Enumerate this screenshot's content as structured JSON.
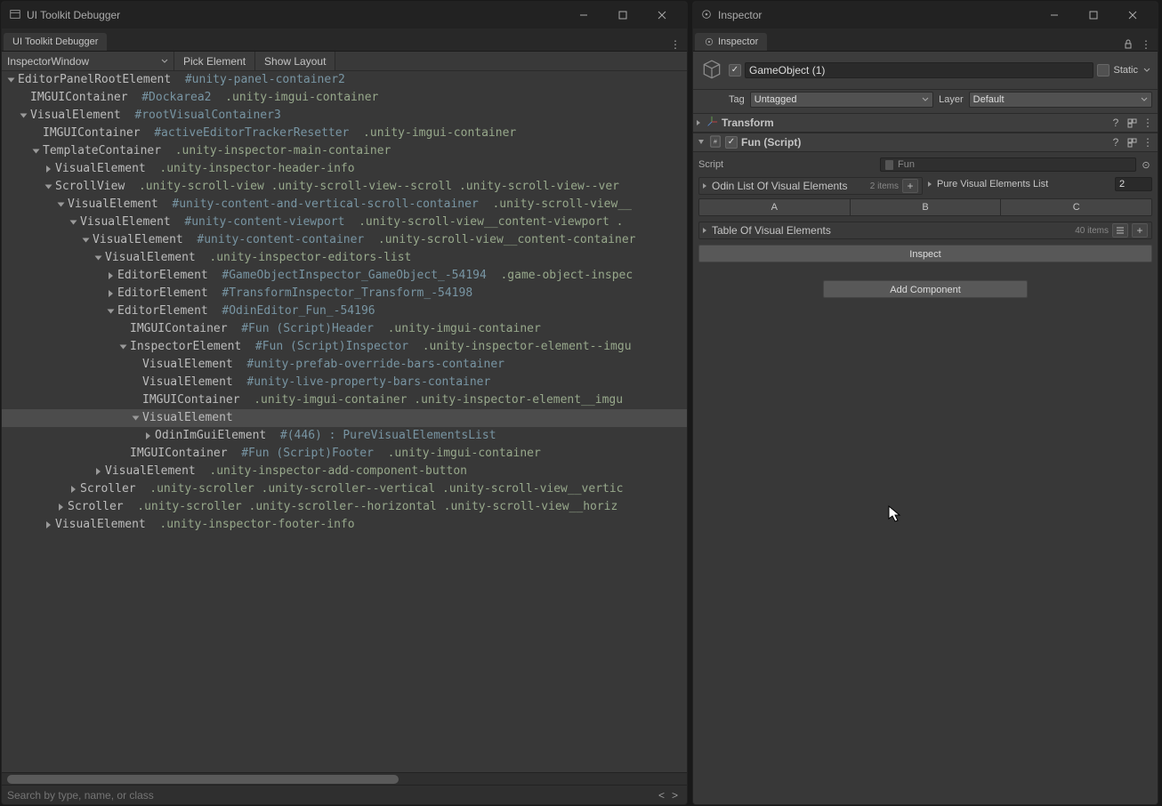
{
  "debugger": {
    "window_title": "UI Toolkit Debugger",
    "tab_label": "UI Toolkit Debugger",
    "target_dropdown": "InspectorWindow",
    "pick_element": "Pick Element",
    "show_layout": "Show Layout",
    "search_placeholder": "Search by type, name, or class",
    "nav_prev": "<",
    "nav_next": ">",
    "tree": [
      {
        "depth": 0,
        "fold": "open",
        "name": "EditorPanelRootElement",
        "id": "#unity-panel-container2",
        "cls": ""
      },
      {
        "depth": 1,
        "fold": "none",
        "name": "IMGUIContainer",
        "id": "#Dockarea2",
        "cls": ".unity-imgui-container"
      },
      {
        "depth": 1,
        "fold": "open",
        "name": "VisualElement",
        "id": "#rootVisualContainer3",
        "cls": ""
      },
      {
        "depth": 2,
        "fold": "none",
        "name": "IMGUIContainer",
        "id": "#activeEditorTrackerResetter",
        "cls": ".unity-imgui-container"
      },
      {
        "depth": 2,
        "fold": "open",
        "name": "TemplateContainer",
        "id": "",
        "cls": ".unity-inspector-main-container"
      },
      {
        "depth": 3,
        "fold": "closed",
        "name": "VisualElement",
        "id": "",
        "cls": ".unity-inspector-header-info"
      },
      {
        "depth": 3,
        "fold": "open",
        "name": "ScrollView",
        "id": "",
        "cls": ".unity-scroll-view  .unity-scroll-view--scroll  .unity-scroll-view--ver"
      },
      {
        "depth": 4,
        "fold": "open",
        "name": "VisualElement",
        "id": "#unity-content-and-vertical-scroll-container",
        "cls": ".unity-scroll-view__"
      },
      {
        "depth": 5,
        "fold": "open",
        "name": "VisualElement",
        "id": "#unity-content-viewport",
        "cls": ".unity-scroll-view__content-viewport  ."
      },
      {
        "depth": 6,
        "fold": "open",
        "name": "VisualElement",
        "id": "#unity-content-container",
        "cls": ".unity-scroll-view__content-container"
      },
      {
        "depth": 7,
        "fold": "open",
        "name": "VisualElement",
        "id": "",
        "cls": ".unity-inspector-editors-list"
      },
      {
        "depth": 8,
        "fold": "closed",
        "name": "EditorElement",
        "id": "#GameObjectInspector_GameObject_-54194",
        "cls": ".game-object-inspec"
      },
      {
        "depth": 8,
        "fold": "closed",
        "name": "EditorElement",
        "id": "#TransformInspector_Transform_-54198",
        "cls": ""
      },
      {
        "depth": 8,
        "fold": "open",
        "name": "EditorElement",
        "id": "#OdinEditor_Fun_-54196",
        "cls": ""
      },
      {
        "depth": 9,
        "fold": "none",
        "name": "IMGUIContainer",
        "id": "#Fun (Script)Header",
        "cls": ".unity-imgui-container"
      },
      {
        "depth": 9,
        "fold": "open",
        "name": "InspectorElement",
        "id": "#Fun (Script)Inspector",
        "cls": ".unity-inspector-element--imgu"
      },
      {
        "depth": 10,
        "fold": "none",
        "name": "VisualElement",
        "id": "#unity-prefab-override-bars-container",
        "cls": ""
      },
      {
        "depth": 10,
        "fold": "none",
        "name": "VisualElement",
        "id": "#unity-live-property-bars-container",
        "cls": ""
      },
      {
        "depth": 10,
        "fold": "none",
        "name": "IMGUIContainer",
        "id": "",
        "cls": ".unity-imgui-container  .unity-inspector-element__imgu"
      },
      {
        "depth": 10,
        "fold": "open",
        "name": "VisualElement",
        "id": "",
        "cls": "",
        "selected": true
      },
      {
        "depth": 11,
        "fold": "closed",
        "name": "OdinImGuiElement",
        "id": "#(446) : PureVisualElementsList",
        "cls": ""
      },
      {
        "depth": 9,
        "fold": "none",
        "name": "IMGUIContainer",
        "id": "#Fun (Script)Footer",
        "cls": ".unity-imgui-container"
      },
      {
        "depth": 7,
        "fold": "closed",
        "name": "VisualElement",
        "id": "",
        "cls": ".unity-inspector-add-component-button"
      },
      {
        "depth": 5,
        "fold": "closed",
        "name": "Scroller",
        "id": "",
        "cls": ".unity-scroller  .unity-scroller--vertical  .unity-scroll-view__vertic"
      },
      {
        "depth": 4,
        "fold": "closed",
        "name": "Scroller",
        "id": "",
        "cls": ".unity-scroller  .unity-scroller--horizontal  .unity-scroll-view__horiz"
      },
      {
        "depth": 3,
        "fold": "closed",
        "name": "VisualElement",
        "id": "",
        "cls": ".unity-inspector-footer-info"
      }
    ]
  },
  "inspector": {
    "window_title": "Inspector",
    "tab_label": "Inspector",
    "go_enabled": true,
    "go_name": "GameObject (1)",
    "static_label": "Static",
    "static_checked": false,
    "tag_label": "Tag",
    "tag_value": "Untagged",
    "layer_label": "Layer",
    "layer_value": "Default",
    "transform_title": "Transform",
    "fun_title": "Fun (Script)",
    "script_label": "Script",
    "script_value": "Fun",
    "odin_list_label": "Odin List Of Visual Elements",
    "odin_list_count": "2 items",
    "pure_list_label": "Pure Visual Elements List",
    "pure_list_value": "2",
    "tabA": "A",
    "tabB": "B",
    "tabC": "C",
    "table_label": "Table Of Visual Elements",
    "table_count": "40 items",
    "inspect_btn": "Inspect",
    "add_component": "Add Component"
  }
}
